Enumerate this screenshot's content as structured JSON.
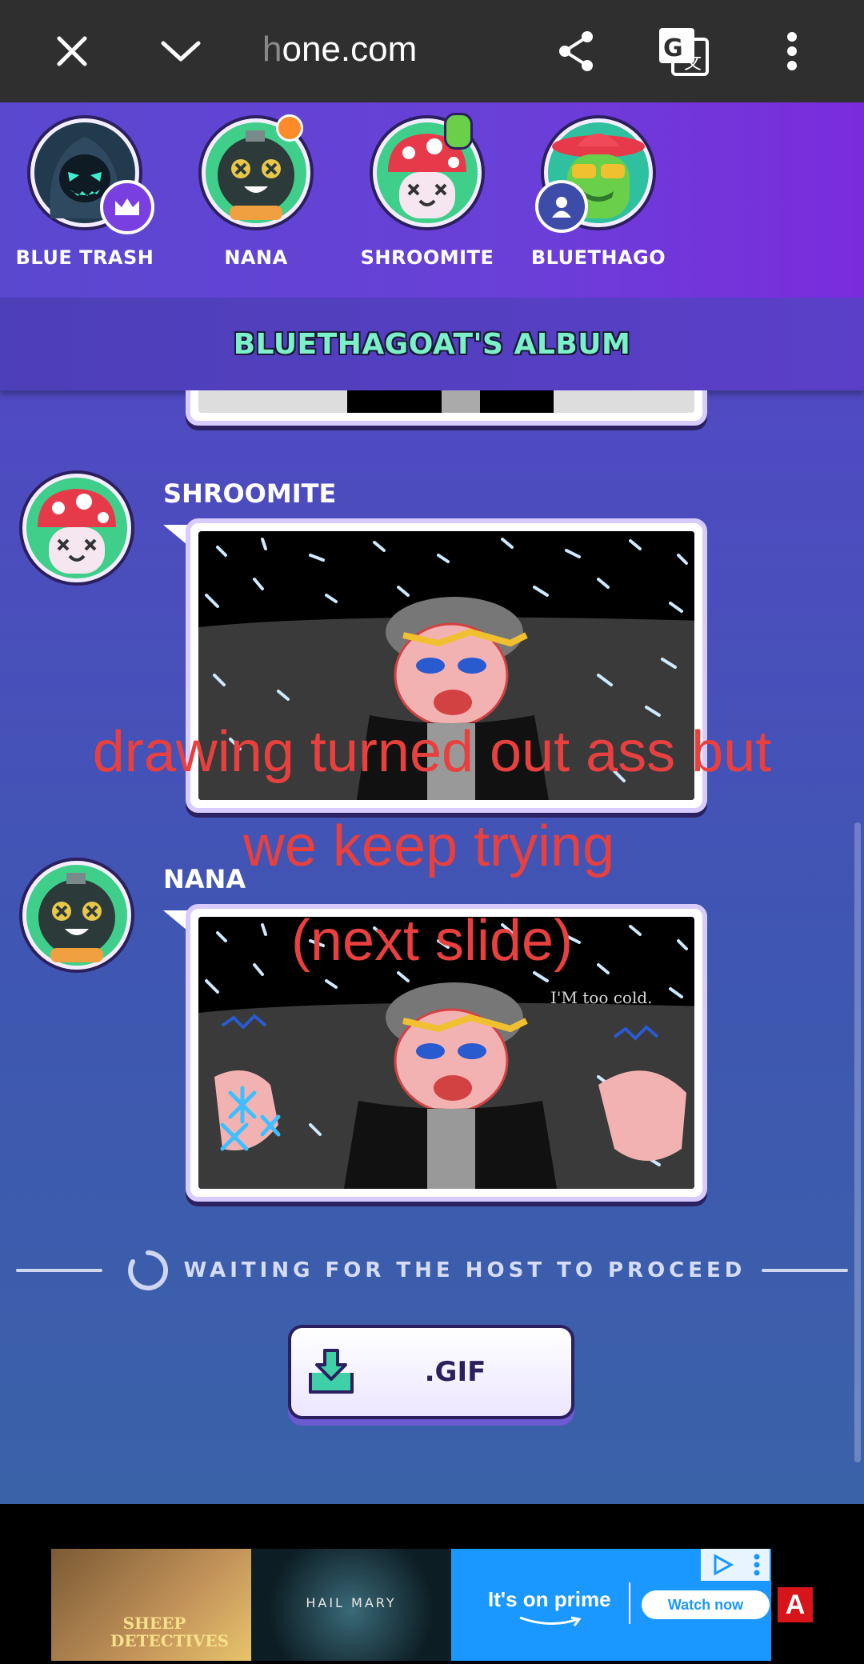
{
  "browser": {
    "url_faded": "h",
    "url_main": "one.com",
    "icons": [
      "close-icon",
      "chevron-down-icon",
      "share-icon",
      "translate-icon",
      "more-vert-icon"
    ]
  },
  "players": [
    {
      "name": "BLUE TRASH",
      "badge": "crown-icon"
    },
    {
      "name": "NANA"
    },
    {
      "name": "SHROOMITE"
    },
    {
      "name": "BLUETHAGO",
      "badge": "user-icon"
    }
  ],
  "album": {
    "title": "BLUETHAGOAT'S ALBUM",
    "entries": [
      {
        "author": "SHROOMITE"
      },
      {
        "author": "NANA",
        "drawing_text": "I'M too cold."
      }
    ]
  },
  "status": {
    "waiting": "WAITING FOR THE HOST TO PROCEED"
  },
  "gif_button": {
    "label": ".GIF"
  },
  "overlay": {
    "line1": "drawing turned out ass but",
    "line2": "we keep trying",
    "line3": "(next slide)"
  },
  "ad": {
    "poster1": "SHEEP DETECTIVES",
    "poster2": "HAIL MARY",
    "tagline": "It's on prime",
    "cta": "Watch now",
    "badge": "A"
  },
  "colors": {
    "accent_title": "#7cf0c8",
    "overlay_text": "#e8403f",
    "topbar": "#2f2f2f",
    "prime_blue": "#1a98ff"
  }
}
